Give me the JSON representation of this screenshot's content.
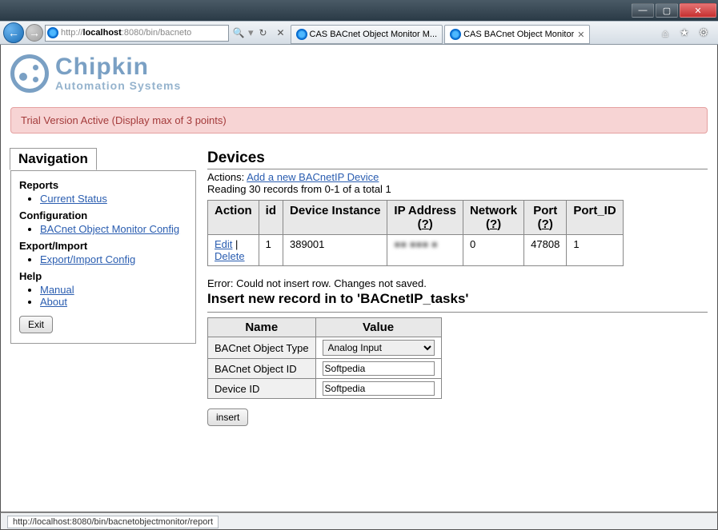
{
  "window": {
    "tabs": [
      {
        "title": "CAS BACnet Object Monitor M...",
        "active": false
      },
      {
        "title": "CAS BACnet Object Monitor",
        "active": true
      }
    ],
    "url_prefix": "http://",
    "url_host": "localhost",
    "url_port": ":8080",
    "url_path": "/bin/bacneto",
    "statusbar": "http://localhost:8080/bin/bacnetobjectmonitor/report"
  },
  "logo": {
    "brand": "Chipkin",
    "subtitle": "Automation Systems"
  },
  "banner": "Trial Version Active (Display max of 3 points)",
  "nav": {
    "title": "Navigation",
    "sections": [
      {
        "heading": "Reports",
        "links": [
          "Current Status"
        ]
      },
      {
        "heading": "Configuration",
        "links": [
          "BACnet Object Monitor Config"
        ]
      },
      {
        "heading": "Export/Import",
        "links": [
          "Export/Import Config"
        ]
      },
      {
        "heading": "Help",
        "links": [
          "Manual",
          "About"
        ]
      }
    ],
    "exit": "Exit"
  },
  "devices": {
    "heading": "Devices",
    "actions_label": "Actions: ",
    "add_link": "Add a new BACnetIP Device",
    "reading": "Reading 30 records from 0-1 of a total 1",
    "cols": [
      "Action",
      "id",
      "Device Instance",
      "IP Address",
      "Network",
      "Port",
      "Port_ID"
    ],
    "help_q": "?",
    "row": {
      "edit": "Edit",
      "sep": " | ",
      "delete": "Delete",
      "id": "1",
      "instance": "389001",
      "ip": "■■ ■■■ ■",
      "network": "0",
      "port": "47808",
      "port_id": "1"
    }
  },
  "insert": {
    "error": "Error: Could not insert row. Changes not saved.",
    "title": "Insert new record in to 'BACnetIP_tasks'",
    "name_col": "Name",
    "value_col": "Value",
    "rows": [
      {
        "name": "BACnet Object Type",
        "type": "select",
        "value": "Analog Input"
      },
      {
        "name": "BACnet Object ID",
        "type": "text",
        "value": "Softpedia"
      },
      {
        "name": "Device ID",
        "type": "text",
        "value": "Softpedia"
      }
    ],
    "button": "insert"
  }
}
